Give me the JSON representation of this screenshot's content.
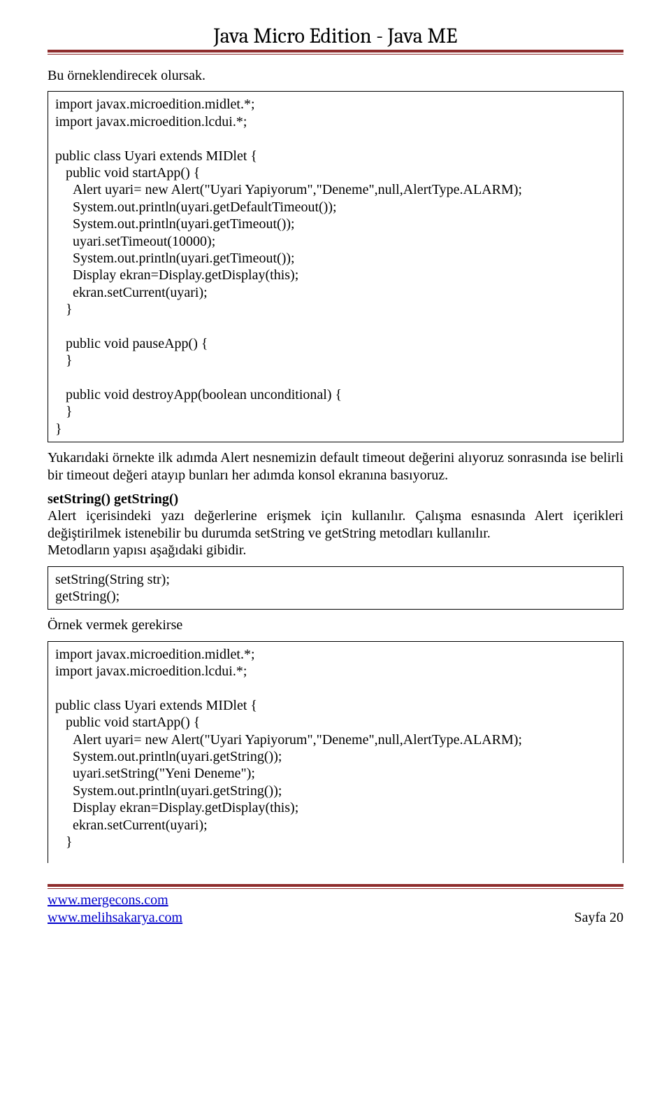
{
  "header": {
    "title": "Java Micro Edition - Java ME"
  },
  "body": {
    "intro": "Bu örneklendirecek olursak.",
    "code1": "import javax.microedition.midlet.*;\nimport javax.microedition.lcdui.*;\n\npublic class Uyari extends MIDlet {\n   public void startApp() {\n     Alert uyari= new Alert(\"Uyari Yapiyorum\",\"Deneme\",null,AlertType.ALARM);\n     System.out.println(uyari.getDefaultTimeout());\n     System.out.println(uyari.getTimeout());\n     uyari.setTimeout(10000);\n     System.out.println(uyari.getTimeout());\n     Display ekran=Display.getDisplay(this);\n     ekran.setCurrent(uyari);\n   }\n\n   public void pauseApp() {\n   }\n\n   public void destroyApp(boolean unconditional) {\n   }\n}",
    "para1": "Yukarıdaki örnekte ilk adımda Alert nesnemizin default timeout değerini alıyoruz sonrasında ise belirli bir timeout değeri atayıp bunları her adımda konsol ekranına basıyoruz.",
    "section_title": "setString() getString()",
    "para2": "Alert içerisindeki yazı değerlerine erişmek için kullanılır. Çalışma esnasında Alert içerikleri değiştirilmek istenebilir bu durumda setString ve getString metodları kullanılır.\nMetodların yapısı aşağıdaki gibidir.",
    "code2": "setString(String str);\ngetString();",
    "para3": "Örnek vermek gerekirse",
    "code3": "import javax.microedition.midlet.*;\nimport javax.microedition.lcdui.*;\n\npublic class Uyari extends MIDlet {\n   public void startApp() {\n     Alert uyari= new Alert(\"Uyari Yapiyorum\",\"Deneme\",null,AlertType.ALARM);\n     System.out.println(uyari.getString());\n     uyari.setString(\"Yeni Deneme\");\n     System.out.println(uyari.getString());\n     Display ekran=Display.getDisplay(this);\n     ekran.setCurrent(uyari);\n   }"
  },
  "footer": {
    "link1": "www.mergecons.com",
    "link2": "www.melihsakarya.com",
    "page": "Sayfa 20"
  }
}
